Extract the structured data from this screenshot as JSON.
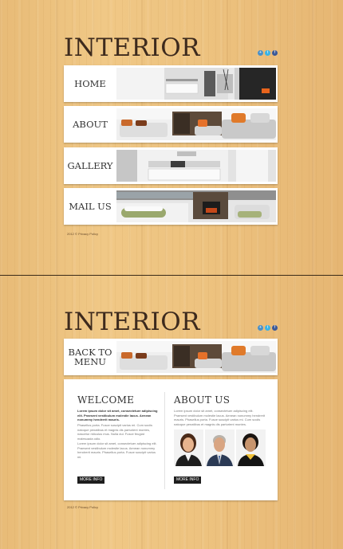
{
  "logo": "INTERIOR",
  "social_icons": [
    "share-icon",
    "twitter-icon",
    "facebook-icon"
  ],
  "menu": {
    "items": [
      {
        "label": "HOME",
        "image": "kitchen-photo"
      },
      {
        "label": "ABOUT",
        "image": "living-room-sofa-photo"
      },
      {
        "label": "GALLERY",
        "image": "kitchen-interior-photo"
      },
      {
        "label": "MAIL US",
        "image": "lounge-fireplace-photo"
      }
    ]
  },
  "footer": {
    "copyright": "2012 © Privacy Policy"
  },
  "back_button": {
    "label": "BACK TO MENU"
  },
  "welcome": {
    "title": "WELCOME",
    "intro": "Lorem ipsum dolor sit amet, consectetuer adipiscing elit. Praesent vestibulum molestie lacus. Aenean nonummy hendrerit mauris.",
    "text1": "Phasellus porta. Fusce suscipit varius mi. Cum sociis natoque penatibus et magnis dis parturient montes, nascetur ridiculus mus. Nulla dui. Fusce feugiat malesuada odio.",
    "text2": "Lorem ipsum dolor sit amet, consectetuer adipiscing elit. Praesent vestibulum molestie lacus. Aenean nonummy hendrerit mauris. Phasellus porta. Fusce suscipit varius mi.",
    "button": "MORE INFO"
  },
  "about": {
    "title": "ABOUT US",
    "text": "Lorem ipsum dolor sit amet, consectetuer adipiscing elit. Praesent vestibulum molestie lacus. Aenean nonummy hendrerit mauris. Phasellus porta. Fusce suscipit varius mi. Cum sociis natoque penatibus et magnis dis parturient montes.",
    "button": "MORE INFO"
  },
  "colors": {
    "wood": "#edc27f",
    "logo": "#3d2a1d",
    "panel": "#ffffff",
    "button": "#1e1e1e"
  }
}
